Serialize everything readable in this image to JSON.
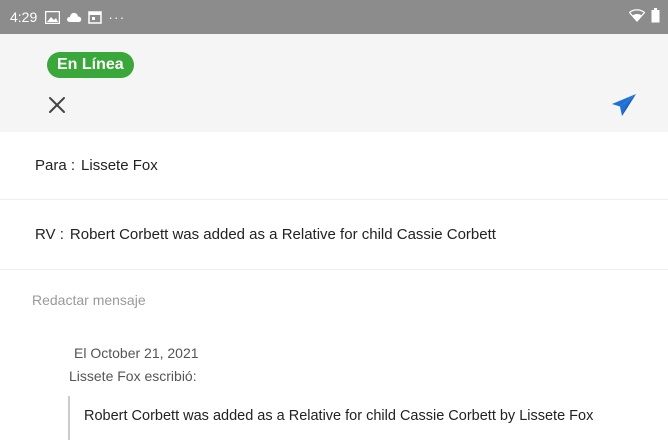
{
  "status_bar": {
    "time": "4:29",
    "more": "···",
    "icons": [
      "image-icon",
      "cloud-icon",
      "calendar-icon"
    ],
    "right_icons": [
      "wifi-icon",
      "battery-icon"
    ]
  },
  "header": {
    "status_badge": "En Línea",
    "badge_color": "#3aa73a",
    "close_icon": "close-icon",
    "send_icon": "send-icon",
    "send_color": "#1f6fd6"
  },
  "message": {
    "to_label": "Para :",
    "to_value": "Lissete Fox",
    "subject_label": "RV :",
    "subject_value": "Robert  Corbett was added as a Relative for child Cassie Corbett",
    "compose_placeholder": "Redactar mensaje",
    "compose_value": ""
  },
  "quoted": {
    "date_line": "El October 21, 2021",
    "author_line": "Lissete Fox escribió:",
    "body": "Robert  Corbett was added as a Relative for child Cassie Corbett by Lissete Fox"
  }
}
